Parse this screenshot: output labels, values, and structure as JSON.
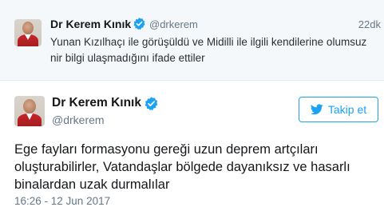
{
  "parent_tweet": {
    "name": "Dr Kerem Kınık",
    "handle": "@drkerem",
    "time": "22dk",
    "text": "Yunan Kızılhaçı ile görüşüldü ve Midilli ile ilgili kendilerine olumsuz nir bilgi ulaşmadığını ifade ettiler"
  },
  "main_tweet": {
    "name": "Dr Kerem Kınık",
    "handle": "@drkerem",
    "follow_label": "Takip et",
    "text": "Ege fayları formasyonu gereği uzun deprem artçıları oluşturabilirler, Vatandaşlar bölgede dayanıksız ve hasarlı binalardan uzak durmalılar",
    "datetime": "16:26 - 12 Jun 2017"
  },
  "colors": {
    "twitter_blue": "#1da1f2",
    "secondary_text": "#657786",
    "parent_background": "#f5f8fa"
  },
  "icons": {
    "verified": "verified-badge-icon",
    "bird": "twitter-bird-icon"
  }
}
